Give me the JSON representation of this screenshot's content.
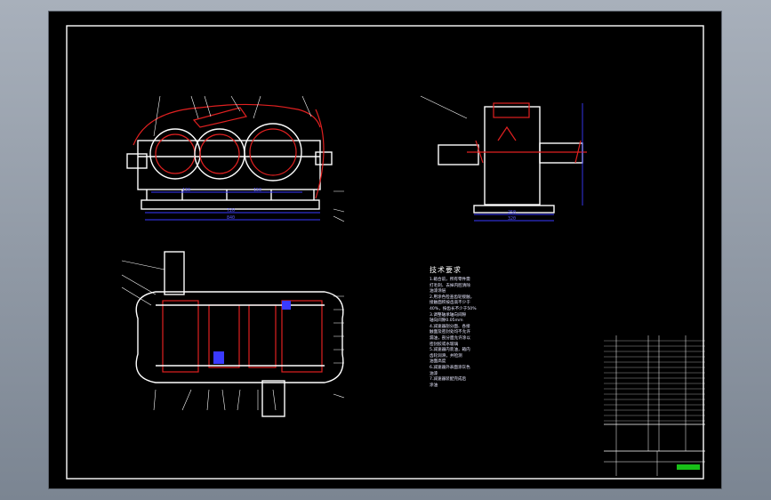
{
  "colors": {
    "background": "#000000",
    "outline": "#ffffff",
    "section": "#e02020",
    "dimension": "#3a3aff",
    "stamp": "#18c018"
  },
  "technical_requirements": {
    "title": "技术要求",
    "lines": [
      "1.箱合前，所有零件需",
      "打毛刺、去掉内腔清除",
      "油漆涂层",
      "2.用涂色检查齿轮接触，",
      "接触面积按齿高不少于",
      "40%，按齿长不少于50%",
      "3.调整轴承轴向间隙",
      "轴向间隙0.05mm",
      "4.减速器剖分面、各接",
      "触面及密封处均不允许",
      "漏油，剖分面允许涂以",
      "密封胶或水玻璃",
      "5.减速器内装油，箱内",
      "齿轮润滑，并检测",
      "油面高度",
      "6.减速器外表面涂灰色",
      "油漆",
      "7.减速器装配完成后",
      "涂油"
    ]
  },
  "dimensions": {
    "front_spacing_1": "130",
    "front_spacing_2": "150",
    "front_overall_1": "720",
    "front_overall_2": "840",
    "side_base_1": "250",
    "side_base_2": "320"
  }
}
